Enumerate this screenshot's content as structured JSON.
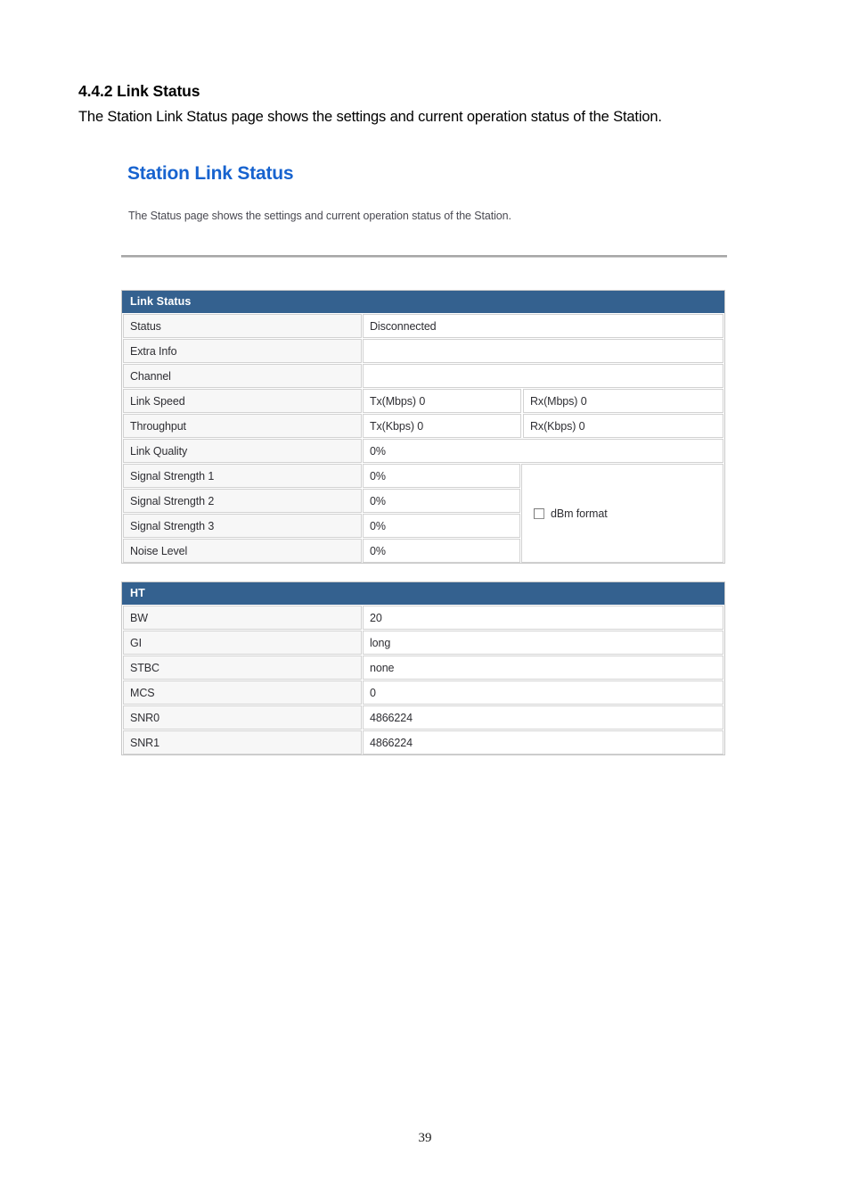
{
  "document": {
    "heading": "4.4.2 Link Status",
    "paragraph": "The Station Link Status page shows the settings and current operation status of the Station.",
    "page_number": "39"
  },
  "screenshot": {
    "title": "Station Link Status",
    "description": "The Status page shows the settings and current operation status of the Station.",
    "colors": {
      "title_blue": "#1763cf",
      "table_header_blue": "#34618f",
      "label_cell_bg": "#f7f7f7",
      "border_gray": "#d2d2d2"
    },
    "link_status_table": {
      "header": "Link Status",
      "rows": [
        {
          "label": "Status",
          "value": "Disconnected"
        },
        {
          "label": "Extra Info",
          "value": ""
        },
        {
          "label": "Channel",
          "value": ""
        },
        {
          "label": "Link Speed",
          "value_tx": "Tx(Mbps)  0",
          "value_rx": "Rx(Mbps)  0"
        },
        {
          "label": "Throughput",
          "value_tx": "Tx(Kbps)  0",
          "value_rx": "Rx(Kbps)  0"
        },
        {
          "label": "Link Quality",
          "value": "0%"
        }
      ],
      "signal_rows": [
        {
          "label": "Signal Strength 1",
          "value": "0%"
        },
        {
          "label": "Signal Strength 2",
          "value": "0%"
        },
        {
          "label": "Signal Strength 3",
          "value": "0%"
        },
        {
          "label": "Noise Level",
          "value": "0%"
        }
      ],
      "dbm_format": {
        "label": "dBm format",
        "checked": false
      }
    },
    "ht_table": {
      "header": "HT",
      "rows": [
        {
          "label": "BW",
          "value": "20"
        },
        {
          "label": "GI",
          "value": "long"
        },
        {
          "label": "STBC",
          "value": "none"
        },
        {
          "label": "MCS",
          "value": "0"
        },
        {
          "label": "SNR0",
          "value": "4866224"
        },
        {
          "label": "SNR1",
          "value": "4866224"
        }
      ]
    }
  }
}
